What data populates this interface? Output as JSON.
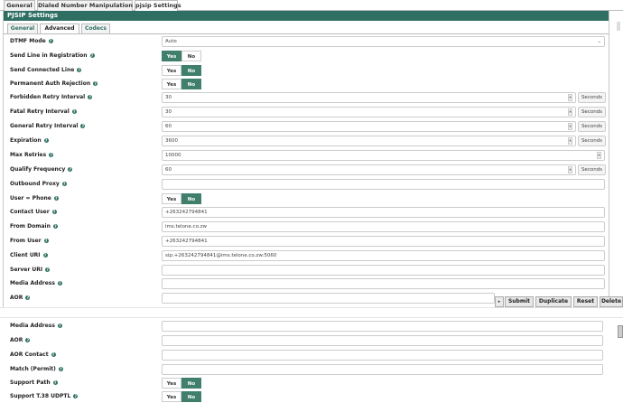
{
  "top_tabs": [
    {
      "label": "General"
    },
    {
      "label": "Dialed Number Manipulation Rules"
    },
    {
      "label": "pjsip Settings"
    }
  ],
  "panel_title": "PJSIP Settings",
  "sub_tabs": [
    {
      "label": "General"
    },
    {
      "label": "Advanced"
    },
    {
      "label": "Codecs"
    }
  ],
  "toggle_labels": {
    "yes": "Yes",
    "no": "No"
  },
  "units": {
    "seconds": "Seconds"
  },
  "fields": {
    "dtmf_mode": {
      "label": "DTMF Mode",
      "value": "Auto"
    },
    "send_line_in_registration": {
      "label": "Send Line in Registration",
      "value": "Yes"
    },
    "send_connected_line": {
      "label": "Send Connected Line",
      "value": "No"
    },
    "permanent_auth_rejection": {
      "label": "Permanent Auth Rejection",
      "value": "No"
    },
    "forbidden_retry_interval": {
      "label": "Forbidden Retry Interval",
      "value": "30"
    },
    "fatal_retry_interval": {
      "label": "Fatal Retry Interval",
      "value": "30"
    },
    "general_retry_interval": {
      "label": "General Retry Interval",
      "value": "60"
    },
    "expiration": {
      "label": "Expiration",
      "value": "3600"
    },
    "max_retries": {
      "label": "Max Retries",
      "value": "10000"
    },
    "qualify_frequency": {
      "label": "Qualify Frequency",
      "value": "60"
    },
    "outbound_proxy": {
      "label": "Outbound Proxy",
      "value": ""
    },
    "user_phone": {
      "label": "User = Phone",
      "value": "No"
    },
    "contact_user": {
      "label": "Contact User",
      "value": "+263242794841"
    },
    "from_domain": {
      "label": "From Domain",
      "value": "ims.telone.co.zw"
    },
    "from_user": {
      "label": "From User",
      "value": "+263242794841"
    },
    "client_uri": {
      "label": "Client URI",
      "value": "sip:+263242794841@ims.telone.co.zw:5060"
    },
    "server_uri": {
      "label": "Server URI",
      "value": ""
    },
    "media_address": {
      "label": "Media Address",
      "value": ""
    },
    "aor": {
      "label": "AOR",
      "value": ""
    }
  },
  "fields_lower": {
    "media_address": {
      "label": "Media Address",
      "value": ""
    },
    "aor": {
      "label": "AOR",
      "value": ""
    },
    "aor_contact": {
      "label": "AOR Contact",
      "value": ""
    },
    "match_permit": {
      "label": "Match (Permit)",
      "value": ""
    },
    "support_path": {
      "label": "Support Path",
      "value": "No"
    },
    "support_t38_udptl": {
      "label": "Support T.38 UDPTL",
      "value": "No"
    }
  },
  "action_bar": {
    "submit": "Submit",
    "duplicate": "Duplicate",
    "reset": "Reset",
    "delete": "Delete"
  }
}
